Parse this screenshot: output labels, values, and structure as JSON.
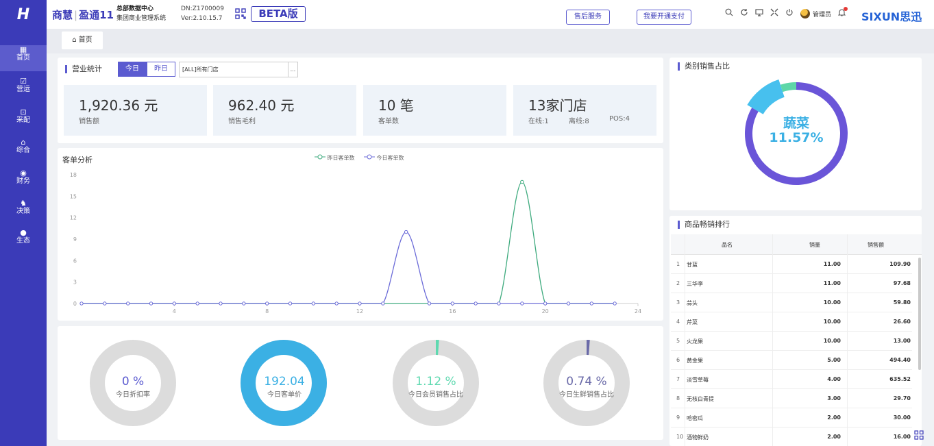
{
  "header": {
    "logo_glyph": "H",
    "brand_a": "商慧",
    "brand_sep": "|",
    "brand_b": "盈通11",
    "company_line1": "总部数据中心",
    "company_line2": "集团商业管理系统",
    "device_no": "DN:Z1700009",
    "version": "Ver:2.10.15.7",
    "qr_icon": "qr-code-icon",
    "beta_label": "BETA版",
    "after_sales_label": "售后服务",
    "payment_label": "我要开通支付",
    "admin_label": "管理员",
    "brand_right": "SIXUN思迅",
    "icons": [
      "search-icon",
      "refresh-icon",
      "monitor-icon",
      "fullscreen-icon",
      "power-icon",
      "avatar-icon",
      "bell-icon"
    ]
  },
  "tabs": {
    "home_label": "首页"
  },
  "sidebar": {
    "items": [
      {
        "label": "首页",
        "icon": "dashboard-icon"
      },
      {
        "label": "营运",
        "icon": "chart-icon"
      },
      {
        "label": "采配",
        "icon": "truck-icon"
      },
      {
        "label": "综合",
        "icon": "bag-icon"
      },
      {
        "label": "财务",
        "icon": "coin-icon"
      },
      {
        "label": "决策",
        "icon": "bike-icon"
      },
      {
        "label": "生态",
        "icon": "ecology-icon"
      }
    ]
  },
  "business": {
    "title": "营业统计",
    "seg_today": "今日",
    "seg_yesterday": "昨日",
    "store_value": "[ALL]所有门店",
    "store_btn": "...",
    "stats": [
      {
        "value": "1,920.36 元",
        "label": "销售额"
      },
      {
        "value": "962.40 元",
        "label": "销售毛利"
      },
      {
        "value": "10 笔",
        "label": "客单数"
      },
      {
        "value": "13家门店",
        "online": "在线:1",
        "offline": "离线:8",
        "pos": "POS:4"
      }
    ]
  },
  "chart_data": {
    "type": "line",
    "title": "客单分析",
    "x": [
      0,
      1,
      2,
      3,
      4,
      5,
      6,
      7,
      8,
      9,
      10,
      11,
      12,
      13,
      14,
      15,
      16,
      17,
      18,
      19,
      20,
      21,
      22,
      23
    ],
    "xticks": [
      4,
      8,
      12,
      16,
      20,
      24
    ],
    "ylim": [
      0,
      18
    ],
    "yticks": [
      0,
      3,
      6,
      9,
      12,
      15,
      18
    ],
    "series": [
      {
        "name": "昨日客单数",
        "color": "#3daa7d",
        "values": [
          0,
          0,
          0,
          0,
          0,
          0,
          0,
          0,
          0,
          0,
          0,
          0,
          0,
          0,
          0,
          0,
          0,
          0,
          0,
          17,
          0,
          0,
          0,
          0
        ]
      },
      {
        "name": "今日客单数",
        "color": "#6b6bd8",
        "values": [
          0,
          0,
          0,
          0,
          0,
          0,
          0,
          0,
          0,
          0,
          0,
          0,
          0,
          0,
          10,
          0,
          0,
          0,
          0,
          0,
          0,
          0,
          0,
          0
        ]
      }
    ],
    "grid": false,
    "legend": "top-center"
  },
  "rings": [
    {
      "value": "0 %",
      "label": "今日折扣率",
      "fraction": 0,
      "color": "#d9d9d9",
      "text_color": "#5b5bd0"
    },
    {
      "value": "192.04",
      "label": "今日客单价",
      "fraction": 1,
      "color": "#3bb0e4",
      "text_color": "#3bb0e4"
    },
    {
      "value": "1.12 %",
      "label": "今日会员销售占比",
      "fraction": 0.0112,
      "color": "#5fd9b0",
      "text_color": "#5fd9b0"
    },
    {
      "value": "0.74 %",
      "label": "今日生鲜销售占比",
      "fraction": 0.0074,
      "color": "#6a6aa8",
      "text_color": "#6a6aa8"
    }
  ],
  "category": {
    "title": "类别销售占比",
    "center_name": "蔬菜",
    "center_pct": "11.57%",
    "slices": [
      {
        "fraction": 0.8343,
        "color": "#6a55d8"
      },
      {
        "fraction": 0.1157,
        "color": "#47c0ee"
      },
      {
        "fraction": 0.05,
        "color": "#5ed7a8"
      }
    ]
  },
  "ranking": {
    "title": "商品畅销排行",
    "headers": [
      "品名",
      "销量",
      "销售额"
    ],
    "rows": [
      {
        "idx": "1",
        "name": "甘蓝",
        "qty": "11.00",
        "amt": "109.90"
      },
      {
        "idx": "2",
        "name": "三华李",
        "qty": "11.00",
        "amt": "97.68"
      },
      {
        "idx": "3",
        "name": "蒜头",
        "qty": "10.00",
        "amt": "59.80"
      },
      {
        "idx": "4",
        "name": "芹菜",
        "qty": "10.00",
        "amt": "26.60"
      },
      {
        "idx": "5",
        "name": "火龙果",
        "qty": "10.00",
        "amt": "13.00"
      },
      {
        "idx": "6",
        "name": "黄金果",
        "qty": "5.00",
        "amt": "494.40"
      },
      {
        "idx": "7",
        "name": "淡雪草莓",
        "qty": "4.00",
        "amt": "635.52"
      },
      {
        "idx": "8",
        "name": "无核白青提",
        "qty": "3.00",
        "amt": "29.70"
      },
      {
        "idx": "9",
        "name": "哈密瓜",
        "qty": "2.00",
        "amt": "30.00"
      },
      {
        "idx": "10",
        "name": "酒物鲜奶",
        "qty": "2.00",
        "amt": "16.00"
      }
    ]
  }
}
